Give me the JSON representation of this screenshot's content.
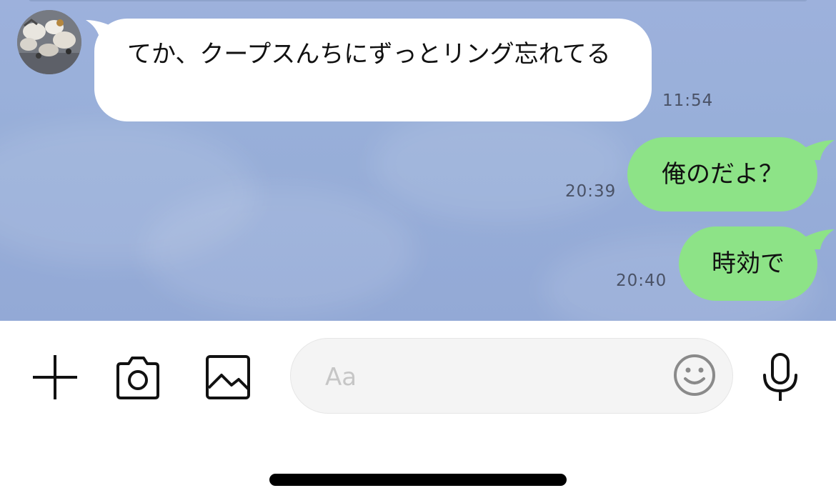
{
  "conversation": {
    "messages": [
      {
        "direction": "incoming",
        "text": "てか、クープスんちにずっとリング忘れてる",
        "time": "11:54"
      },
      {
        "direction": "outgoing",
        "text": "俺のだよ？",
        "time": "20:39"
      },
      {
        "direction": "outgoing",
        "text": "時効で",
        "time": "20:40"
      }
    ]
  },
  "composer": {
    "placeholder": "Aa"
  },
  "icons": {
    "add": "plus-icon",
    "camera": "camera-icon",
    "gallery": "image-icon",
    "emoji": "smiley-icon",
    "voice": "microphone-icon"
  },
  "colors": {
    "chat_background": "#98afd9",
    "incoming_bubble": "#ffffff",
    "outgoing_bubble": "#8de387",
    "timestamp": "#4a5266"
  }
}
